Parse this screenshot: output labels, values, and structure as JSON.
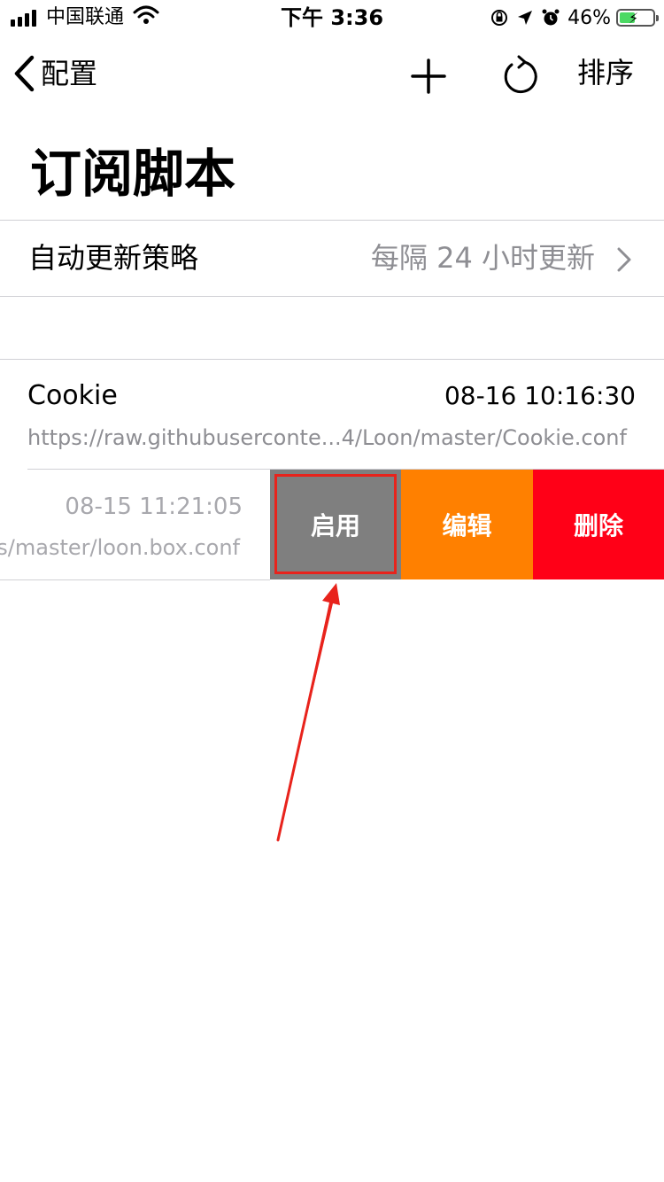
{
  "status_bar": {
    "carrier": "中国联通",
    "time": "下午 3:36",
    "battery_percent": "46%",
    "battery_level": 0.46,
    "icons": [
      "signal-icon",
      "wifi-icon",
      "orientation-lock-icon",
      "location-icon",
      "alarm-icon",
      "battery-icon"
    ]
  },
  "nav": {
    "back_label": "配置",
    "add_icon": "plus-icon",
    "refresh_icon": "refresh-icon",
    "sort_label": "排序"
  },
  "page_title": "订阅脚本",
  "auto_update": {
    "label": "自动更新策略",
    "value": "每隔 24 小时更新"
  },
  "scripts": [
    {
      "name": "Cookie",
      "time": "08-16 10:16:30",
      "url": "https://raw.githubuserconte...4/Loon/master/Cookie.conf"
    },
    {
      "time": "08-15 11:21:05",
      "url": "s/master/loon.box.conf",
      "actions": {
        "enable": "启用",
        "edit": "编辑",
        "delete": "删除"
      }
    }
  ],
  "colors": {
    "enable_bg": "#7f7f7f",
    "edit_bg": "#ff8000",
    "delete_bg": "#ff0017",
    "annotation": "#e8231c",
    "secondary_text": "#8e8e93"
  }
}
